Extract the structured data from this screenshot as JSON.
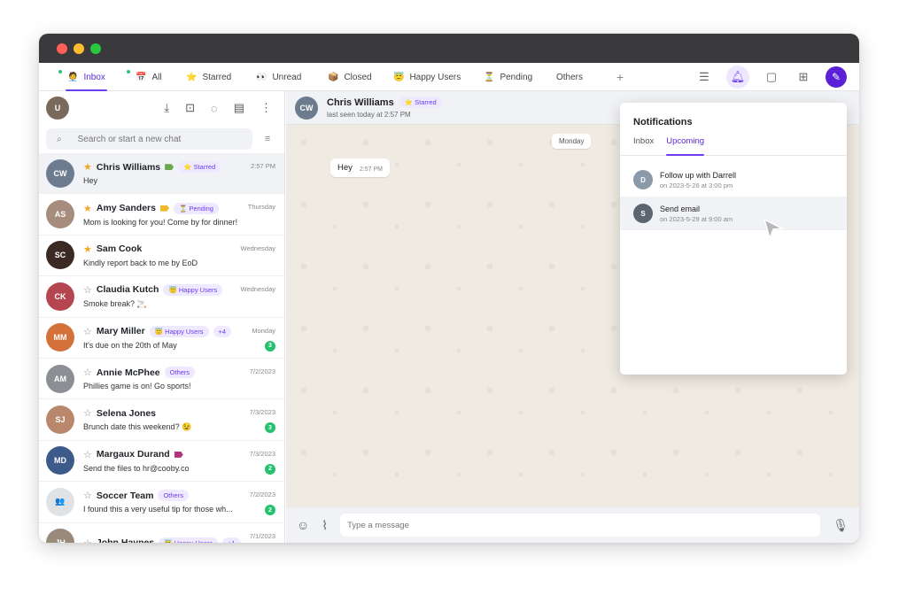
{
  "tabs": [
    {
      "label": "Inbox",
      "icon": "🧑‍💼",
      "active": true,
      "dot": true
    },
    {
      "label": "All",
      "icon": "📅",
      "active": false,
      "dot": true
    },
    {
      "label": "Starred",
      "icon": "⭐",
      "active": false,
      "dot": false
    },
    {
      "label": "Unread",
      "icon": "👀",
      "active": false,
      "dot": false
    },
    {
      "label": "Closed",
      "icon": "📦",
      "active": false,
      "dot": false
    },
    {
      "label": "Happy Users",
      "icon": "😇",
      "active": false,
      "dot": false
    },
    {
      "label": "Pending",
      "icon": "⏳",
      "active": false,
      "dot": false
    },
    {
      "label": "Others",
      "icon": "",
      "active": false,
      "dot": false
    }
  ],
  "add_tab": "+",
  "search": {
    "placeholder": "Search or start a new chat"
  },
  "chats": [
    {
      "name": "Chris Williams",
      "initials": "CW",
      "avatar_color": "#6d7b8f",
      "starred": true,
      "flag_color": "#6aa84f",
      "pill": "⭐ Starred",
      "pill2": "",
      "time": "2:57 PM",
      "preview": "Hey",
      "badge": "",
      "selected": true
    },
    {
      "name": "Amy Sanders",
      "initials": "AS",
      "avatar_color": "#a58c7c",
      "starred": true,
      "flag_color": "#f1b827",
      "pill": "⏳ Pending",
      "pill2": "",
      "time": "Thursday",
      "preview": "Mom is looking for you! Come by for dinner!",
      "badge": "",
      "selected": false
    },
    {
      "name": "Sam Cook",
      "initials": "SC",
      "avatar_color": "#3b2a24",
      "starred": true,
      "flag_color": "",
      "pill": "",
      "pill2": "",
      "time": "Wednesday",
      "preview": "Kindly report back to me by EoD",
      "badge": "",
      "selected": false
    },
    {
      "name": "Claudia Kutch",
      "initials": "CK",
      "avatar_color": "#b5464f",
      "starred": false,
      "flag_color": "",
      "pill": "😇 Happy Users",
      "pill2": "",
      "time": "Wednesday",
      "preview": "Smoke break? 🚬",
      "badge": "",
      "selected": false
    },
    {
      "name": "Mary Miller",
      "initials": "MM",
      "avatar_color": "#d4713a",
      "starred": false,
      "flag_color": "",
      "pill": "😇 Happy Users",
      "pill2": "+4",
      "time": "Monday",
      "preview": "It's due on the 20th of May",
      "badge": "3",
      "selected": false
    },
    {
      "name": "Annie McPhee",
      "initials": "AM",
      "avatar_color": "#8b8f94",
      "starred": false,
      "flag_color": "",
      "pill": "Others",
      "pill2": "",
      "time": "7/2/2023",
      "preview": "Phillies game is on! Go sports!",
      "badge": "",
      "selected": false
    },
    {
      "name": "Selena Jones",
      "initials": "SJ",
      "avatar_color": "#b9876b",
      "starred": false,
      "flag_color": "",
      "pill": "",
      "pill2": "",
      "time": "7/3/2023",
      "preview": "Brunch date this weekend? 😉",
      "badge": "3",
      "selected": false
    },
    {
      "name": "Margaux Durand",
      "initials": "MD",
      "avatar_color": "#3c5a8a",
      "starred": false,
      "flag_color": "#b0357d",
      "pill": "",
      "pill2": "",
      "time": "7/3/2023",
      "preview": "Send the files to hr@cooby.co",
      "badge": "2",
      "selected": false
    },
    {
      "name": "Soccer Team",
      "initials": "👥",
      "avatar_color": "#dfe3e6",
      "starred": false,
      "flag_color": "",
      "pill": "Others",
      "pill2": "",
      "time": "7/2/2023",
      "preview": "I found this a very useful tip for those wh...",
      "badge": "2",
      "selected": false
    },
    {
      "name": "John Haynes",
      "initials": "JH",
      "avatar_color": "#9a8a7c",
      "starred": false,
      "flag_color": "",
      "pill": "😇 Happy Users",
      "pill2": "+1",
      "time": "7/1/2023",
      "preview": "",
      "badge": "",
      "selected": false
    }
  ],
  "conversation": {
    "name": "Chris Williams",
    "pill": "⭐ Starred",
    "status": "last seen today at 2:57 PM",
    "date_chip": "Monday",
    "message": "Hey",
    "message_time": "2:57 PM"
  },
  "composer": {
    "placeholder": "Type a message"
  },
  "notifications": {
    "title": "Notifications",
    "tabs": [
      "Inbox",
      "Upcoming"
    ],
    "active_tab": "Upcoming",
    "items": [
      {
        "title": "Follow up with Darrell",
        "when": "on 2023-5-26 at 3:00 pm",
        "initials": "D",
        "avatar_color": "#8a9aa8"
      },
      {
        "title": "Send email",
        "when": "on 2023-5-29 at 9:00 am",
        "initials": "S",
        "avatar_color": "#5b6670"
      }
    ]
  },
  "colors": {
    "accent": "#6b3cf0",
    "badge": "#25c26e",
    "chat_bg": "#efeae2"
  }
}
